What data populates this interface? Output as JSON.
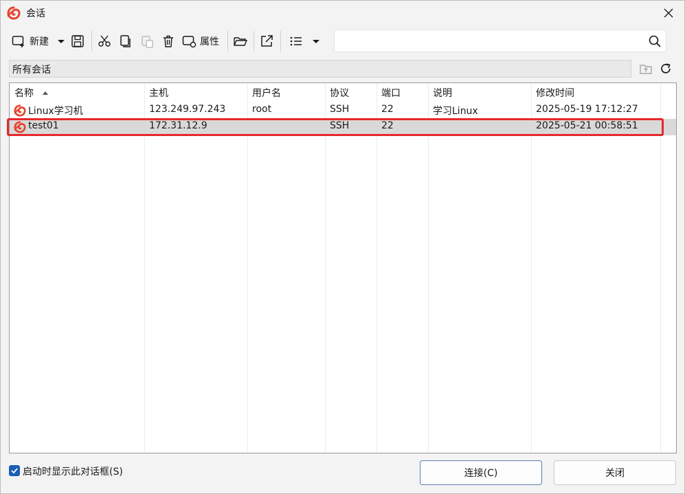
{
  "window": {
    "title": "会话",
    "brand_color": "#e8432d"
  },
  "toolbar": {
    "new_label": "新建",
    "properties_label": "属性",
    "icons": [
      "new-session-icon",
      "dropdown-arrow-icon",
      "save-icon",
      "cut-icon",
      "copy-icon",
      "paste-icon",
      "delete-icon",
      "properties-icon",
      "open-folder-icon",
      "export-icon",
      "list-view-icon",
      "dropdown-arrow-icon"
    ],
    "search": {
      "value": "",
      "placeholder": ""
    }
  },
  "path": {
    "label": "所有会话"
  },
  "table": {
    "columns": [
      "名称",
      "主机",
      "用户名",
      "协议",
      "端口",
      "说明",
      "修改时间"
    ],
    "sort_column": "名称",
    "rows": [
      {
        "name": "Linux学习机",
        "host": "123.249.97.243",
        "user": "root",
        "protocol": "SSH",
        "port": "22",
        "desc": "学习Linux",
        "modified": "2025-05-19 17:12:27",
        "selected": false
      },
      {
        "name": "test01",
        "host": "172.31.12.9",
        "user": "",
        "protocol": "SSH",
        "port": "22",
        "desc": "",
        "modified": "2025-05-21 00:58:51",
        "selected": true
      }
    ],
    "highlight_color": "#e6282b"
  },
  "footer": {
    "startup_checkbox_label": "启动时显示此对话框(S)",
    "startup_checked": true,
    "connect_label": "连接(C)",
    "close_label": "关闭"
  }
}
